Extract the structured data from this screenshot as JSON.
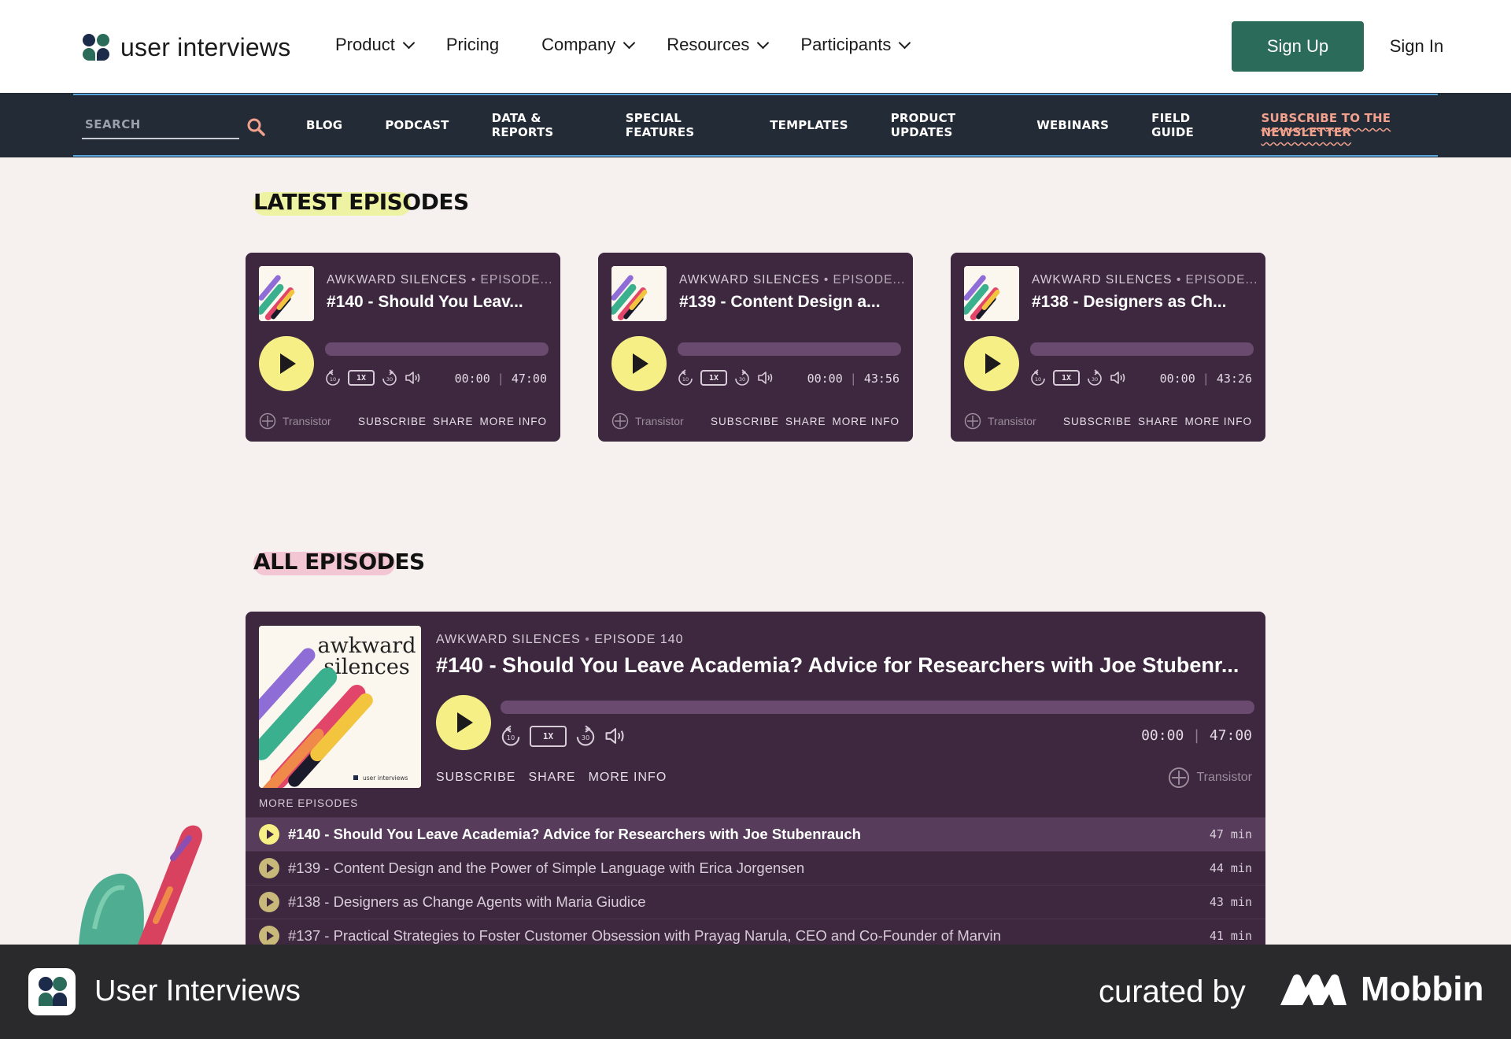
{
  "header": {
    "logo_text": "user interviews",
    "nav": [
      {
        "label": "Product",
        "dropdown": true
      },
      {
        "label": "Pricing",
        "dropdown": false
      },
      {
        "label": "Company",
        "dropdown": true
      },
      {
        "label": "Resources",
        "dropdown": true
      },
      {
        "label": "Participants",
        "dropdown": true
      }
    ],
    "signup_label": "Sign Up",
    "signin_label": "Sign In"
  },
  "subnav": {
    "search_placeholder": "SEARCH",
    "links": [
      "BLOG",
      "PODCAST",
      "DATA & REPORTS",
      "SPECIAL FEATURES",
      "TEMPLATES",
      "PRODUCT UPDATES",
      "WEBINARS",
      "FIELD GUIDE"
    ],
    "newsletter": "SUBSCRIBE TO THE NEWSLETTER"
  },
  "latest": {
    "heading": "LATEST EPISODES",
    "cards": [
      {
        "show": "AWKWARD SILENCES",
        "episode": "EPISODE...",
        "title": "#140 - Should You Leav...",
        "rate": "1X",
        "current": "00:00",
        "total": "47:00",
        "brand": "Transistor",
        "subscribe": "SUBSCRIBE",
        "share": "SHARE",
        "more": "MORE INFO"
      },
      {
        "show": "AWKWARD SILENCES",
        "episode": "EPISODE...",
        "title": "#139 - Content Design a...",
        "rate": "1X",
        "current": "00:00",
        "total": "43:56",
        "brand": "Transistor",
        "subscribe": "SUBSCRIBE",
        "share": "SHARE",
        "more": "MORE INFO"
      },
      {
        "show": "AWKWARD SILENCES",
        "episode": "EPISODE...",
        "title": "#138 - Designers as Ch...",
        "rate": "1X",
        "current": "00:00",
        "total": "43:26",
        "brand": "Transistor",
        "subscribe": "SUBSCRIBE",
        "share": "SHARE",
        "more": "MORE INFO"
      }
    ]
  },
  "all": {
    "heading": "ALL EPISODES",
    "player": {
      "art_line1": "awkward",
      "art_line2": "silences",
      "art_credit": "user interviews",
      "show": "AWKWARD SILENCES",
      "episode": "EPISODE 140",
      "title": "#140 - Should You Leave Academia? Advice for Researchers with Joe Stubenr...",
      "rate": "1X",
      "current": "00:00",
      "total": "47:00",
      "subscribe": "SUBSCRIBE",
      "share": "SHARE",
      "more": "MORE INFO",
      "brand": "Transistor",
      "more_episodes_label": "MORE EPISODES",
      "episodes": [
        {
          "title": "#140 - Should You Leave Academia? Advice for Researchers with Joe Stubenrauch",
          "duration": "47 min",
          "active": true
        },
        {
          "title": "#139 - Content Design and the Power of Simple Language with Erica Jorgensen",
          "duration": "44 min",
          "active": false
        },
        {
          "title": "#138 - Designers as Change Agents with Maria Giudice",
          "duration": "43 min",
          "active": false
        },
        {
          "title": "#137 - Practical Strategies to Foster Customer Obsession with Prayag Narula, CEO and Co-Founder of Marvin",
          "duration": "41 min",
          "active": false
        }
      ]
    }
  },
  "footer": {
    "app_name": "User Interviews",
    "curated_by": "curated by",
    "mobbin": "Mobbin"
  },
  "colors": {
    "brand_green": "#2b6b59",
    "player_bg": "#3e2840",
    "play_yellow": "#f5ef86",
    "subnav_bg": "#232b37",
    "newsletter_accent": "#f2a18c"
  }
}
